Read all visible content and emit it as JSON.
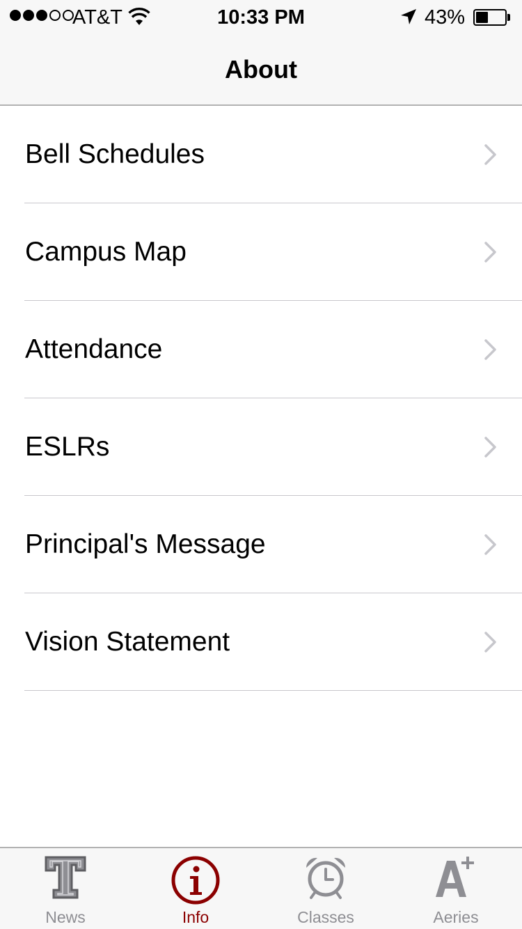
{
  "status_bar": {
    "carrier": "AT&T",
    "time": "10:33 PM",
    "battery_percent_text": "43%",
    "battery_level": 0.43,
    "signal_bars_filled": 3,
    "signal_bars_total": 5
  },
  "nav": {
    "title": "About"
  },
  "list": {
    "items": [
      {
        "label": "Bell Schedules"
      },
      {
        "label": "Campus Map"
      },
      {
        "label": "Attendance"
      },
      {
        "label": "ESLRs"
      },
      {
        "label": "Principal's Message"
      },
      {
        "label": "Vision Statement"
      }
    ]
  },
  "tabbar": {
    "tabs": [
      {
        "label": "News",
        "icon": "t-logo-icon",
        "active": false
      },
      {
        "label": "Info",
        "icon": "info-icon",
        "active": true
      },
      {
        "label": "Classes",
        "icon": "alarm-clock-icon",
        "active": false
      },
      {
        "label": "Aeries",
        "icon": "a-plus-icon",
        "active": false
      }
    ]
  },
  "colors": {
    "accent": "#8b0000",
    "inactive": "#8e8e93",
    "bar_background": "#f7f7f7",
    "separator": "#c8c7cc"
  }
}
